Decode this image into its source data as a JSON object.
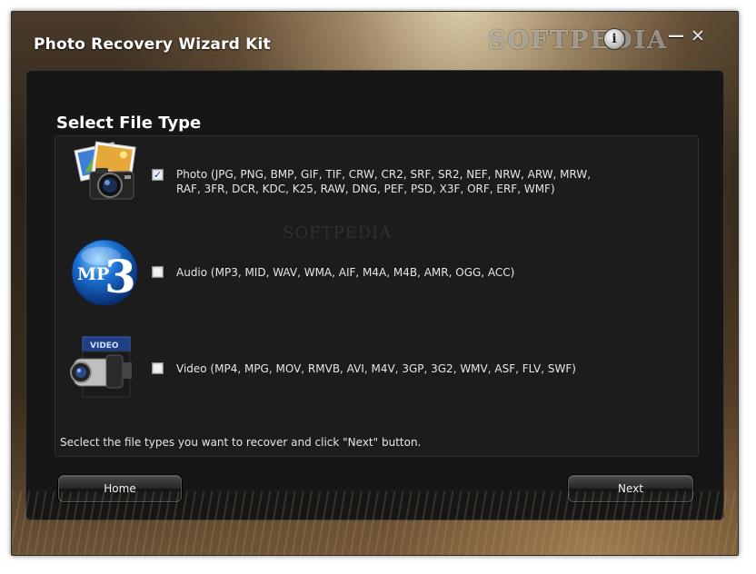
{
  "window": {
    "title": "Photo Recovery Wizard Kit",
    "brand": "SOFTPEDIA",
    "info_glyph": "i",
    "minimize_glyph": "—",
    "close_glyph": "✕"
  },
  "watermark": "SOFTPEDIA",
  "section_title": "Select File Type",
  "file_types": [
    {
      "icon": "photo-camera-icon",
      "label": "Photo (JPG, PNG, BMP, GIF, TIF, CRW, CR2, SRF, SR2, NEF, NRW, ARW, MRW, RAF, 3FR, DCR, KDC, K25, RAW, DNG, PEF, PSD, X3F, ORF, ERF, WMF)",
      "checked": true,
      "check_glyph": "✓"
    },
    {
      "icon": "mp3-audio-icon",
      "label": "Audio (MP3, MID, WAV, WMA, AIF, M4A, M4B, AMR, OGG, ACC)",
      "checked": false,
      "check_glyph": ""
    },
    {
      "icon": "video-camera-icon",
      "label": "Video (MP4, MPG, MOV, RMVB, AVI, M4V, 3GP, 3G2, WMV, ASF, FLV, SWF)",
      "checked": false,
      "check_glyph": ""
    }
  ],
  "hint": "Seclect the file types you want to recover and click \"Next\" button.",
  "buttons": {
    "home": "Home",
    "next": "Next"
  },
  "icon_text": {
    "mp3": "MP",
    "mp3_digit": "3",
    "video": "VIDEO"
  },
  "colors": {
    "panel_bg": "#161616",
    "text": "#e6e6e6",
    "checkbox_mark": "#123f8c",
    "mp3_blue": "#1a6fd1"
  }
}
